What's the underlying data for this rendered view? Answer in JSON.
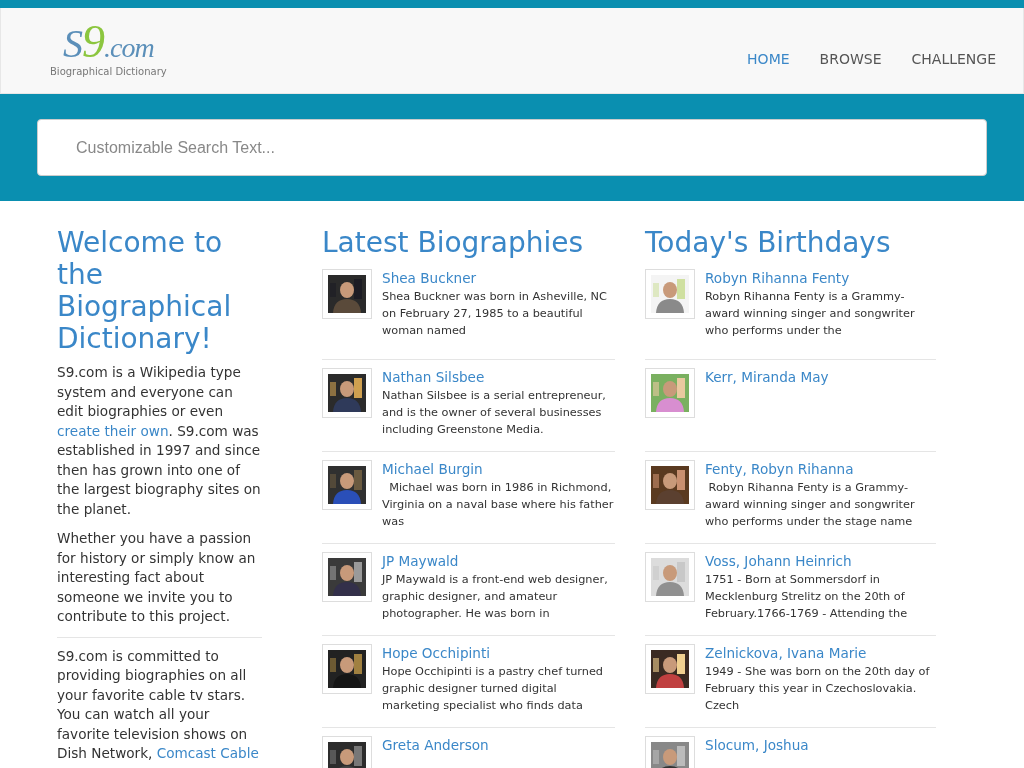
{
  "header": {
    "logo": {
      "brand": "S9",
      "suffix": ".com",
      "tagline": "Biographical Dictionary"
    },
    "nav": [
      {
        "label": "HOME",
        "selected": true
      },
      {
        "label": "BROWSE",
        "selected": false
      },
      {
        "label": "CHALLENGE",
        "selected": false
      }
    ]
  },
  "search": {
    "placeholder": "Customizable Search Text..."
  },
  "welcome": {
    "title": "Welcome to the Biographical Dictionary!",
    "paragraphs": [
      [
        {
          "text": "S9.com is a Wikipedia type system and everyone can edit biographies or even "
        },
        {
          "text": "create their own",
          "kind": "link"
        },
        {
          "text": ". S9.com was established in 1997 and since then has grown into one of the largest biography sites on the planet."
        }
      ],
      [
        {
          "text": "Whether you have a passion for history or simply know an interesting fact about someone we invite you to contribute to this project."
        }
      ],
      [
        {
          "text": "S9.com is committed to providing biographies on all your favorite cable tv stars. You can watch all your favorite television shows on Dish Network, "
        },
        {
          "text": "Comcast Cable",
          "kind": "link"
        }
      ]
    ]
  },
  "latest": {
    "title": "Latest Biographies",
    "items": [
      {
        "name": "Shea Buckner",
        "summary": "Shea Buckner was born in Asheville, NC on February 27, 1985 to a beautiful woman named"
      },
      {
        "name": "Nathan Silsbee",
        "summary": "Nathan Silsbee is a serial entrepreneur, and is the owner of several businesses including Greenstone Media."
      },
      {
        "name": "Michael Burgin",
        "summary": "  Michael was born in 1986 in Richmond, Virginia on a naval base where his father was"
      },
      {
        "name": "JP Maywald",
        "summary": "JP Maywald is a front-end web designer, graphic designer, and amateur photographer. He was born in"
      },
      {
        "name": "Hope Occhipinti",
        "summary": "Hope Occhipinti is a pastry chef turned graphic designer turned digital marketing specialist who finds data"
      },
      {
        "name": "Greta Anderson"
      }
    ]
  },
  "birthdays": {
    "title": "Today's Birthdays",
    "items": [
      {
        "name": "Robyn Rihanna Fenty",
        "summary": "Robyn Rihanna Fenty is a Grammy-award winning singer and songwriter who performs under the"
      },
      {
        "name": "Kerr, Miranda May"
      },
      {
        "name": "Fenty, Robyn Rihanna",
        "summary": " Robyn Rihanna Fenty is a Grammy-award winning singer and songwriter who performs under the stage name"
      },
      {
        "name": "Voss, Johann Heinrich",
        "summary": "1751 - Born at Sommersdorf in Mecklenburg Strelitz on the 20th of February.1766-1769 - Attending the"
      },
      {
        "name": "Zelnickova, Ivana Marie",
        "summary": "1949 - She was born on the 20th day of February this year in Czechoslovakia. Czech"
      },
      {
        "name": "Slocum, Joshua"
      }
    ]
  }
}
